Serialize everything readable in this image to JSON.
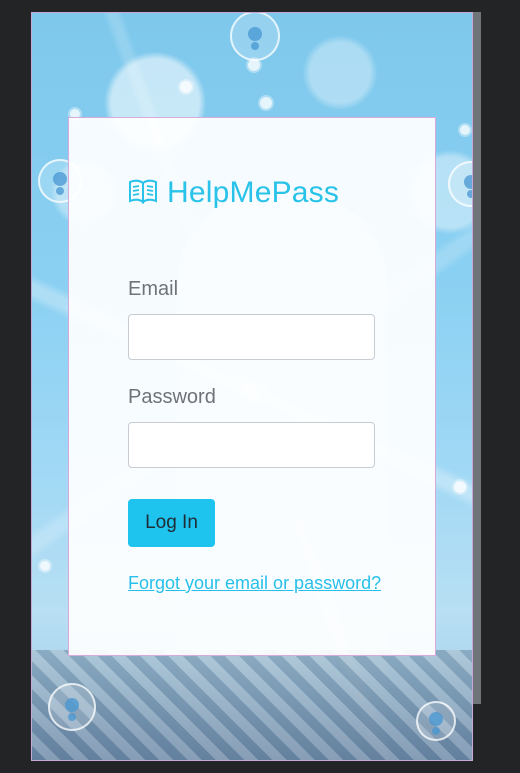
{
  "brand": {
    "name": "HelpMePass",
    "accent_color": "#29C2E8",
    "logo_icon": "open-book-icon"
  },
  "form": {
    "email_label": "Email",
    "email_value": "",
    "email_placeholder": "",
    "password_label": "Password",
    "password_value": "",
    "password_placeholder": "",
    "login_button_label": "Log In",
    "forgot_link_text": "Forgot your email or password?"
  }
}
